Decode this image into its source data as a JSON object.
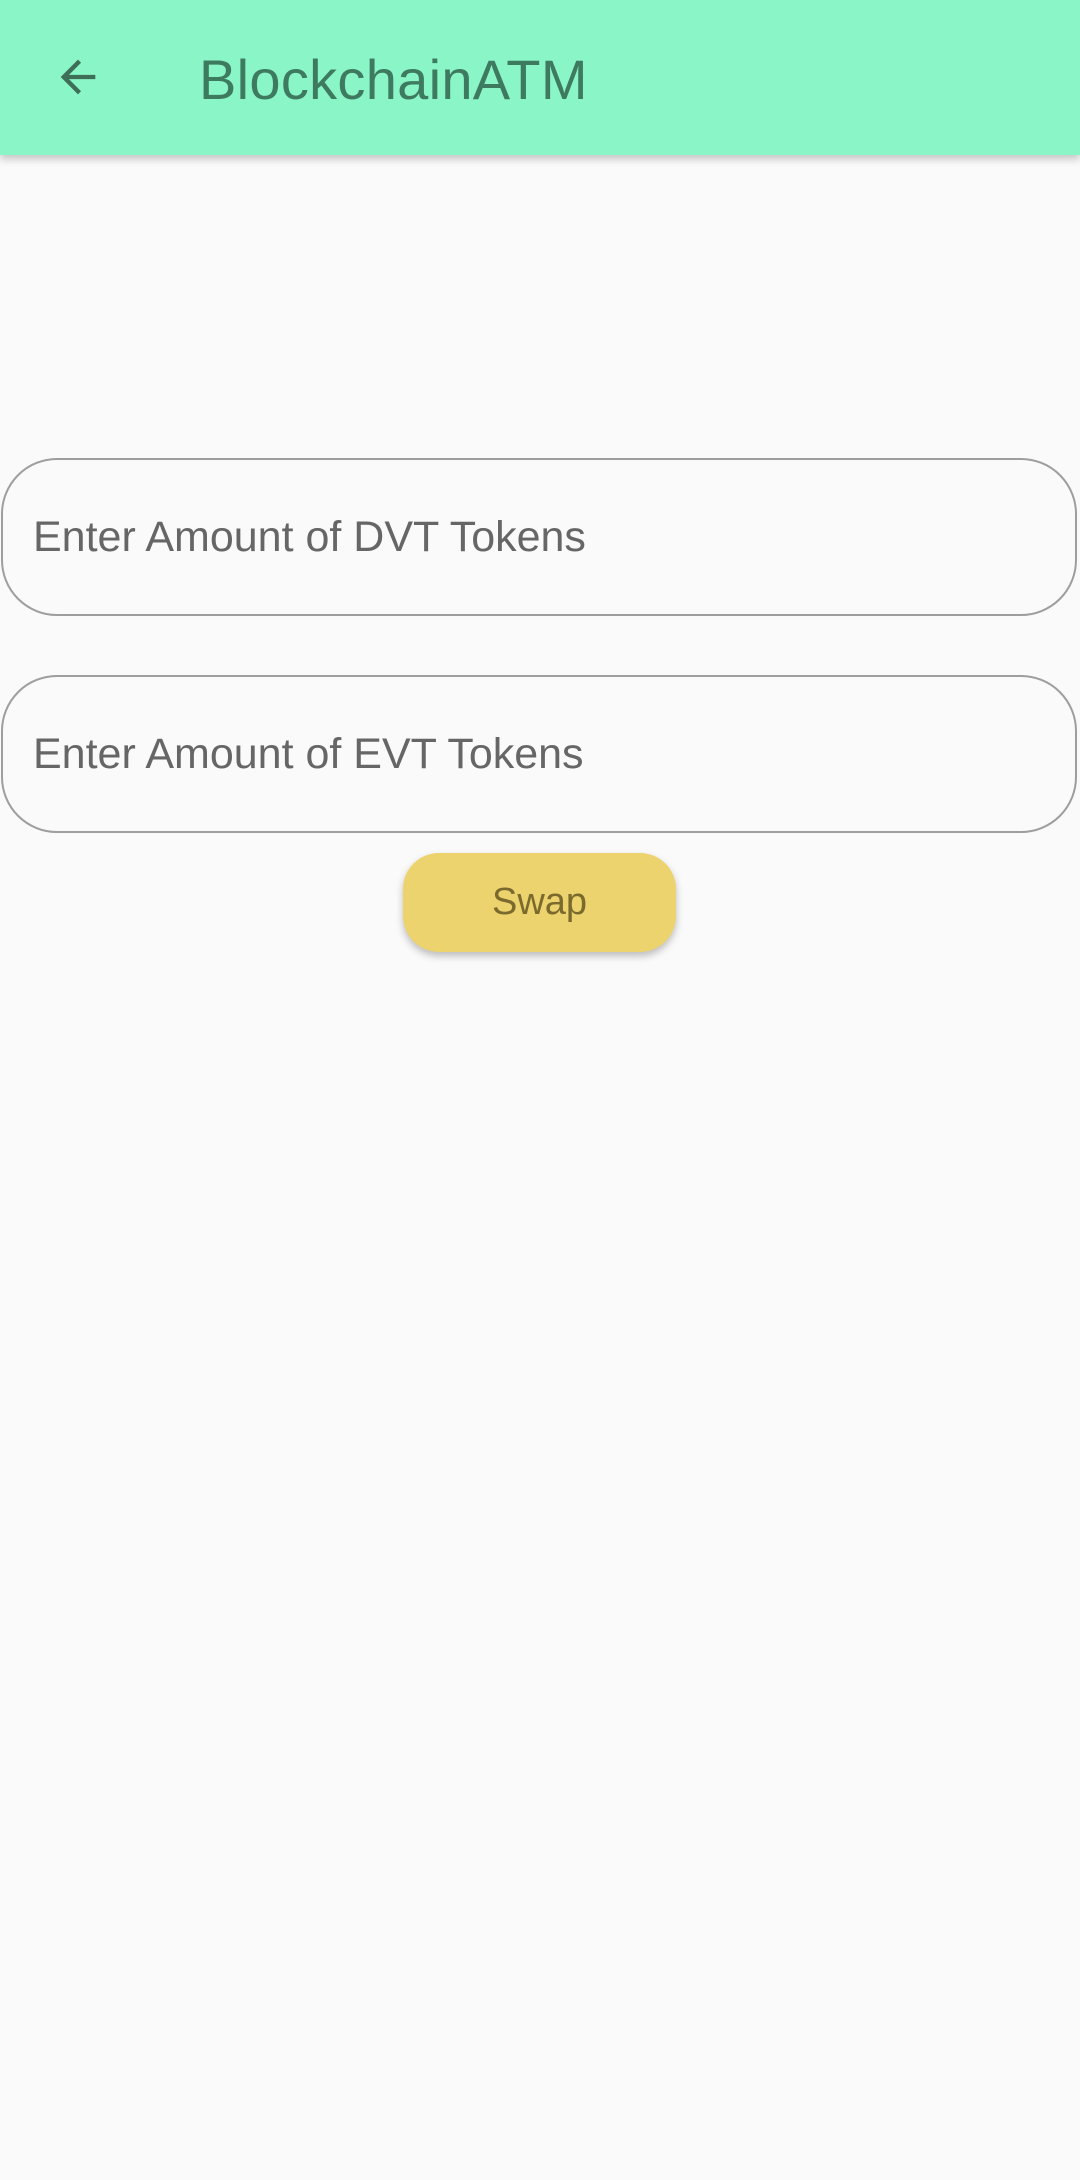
{
  "app_bar": {
    "title": "BlockchainATM",
    "back_icon": "arrow-back-icon",
    "background_color": "#8af5c6",
    "title_color": "#3e7a60"
  },
  "form": {
    "dvt_input": {
      "placeholder": "Enter Amount of DVT Tokens",
      "value": ""
    },
    "evt_input": {
      "placeholder": "Enter Amount of EVT Tokens",
      "value": ""
    },
    "swap_label": "Swap",
    "swap_button_color": "#edd36d"
  }
}
